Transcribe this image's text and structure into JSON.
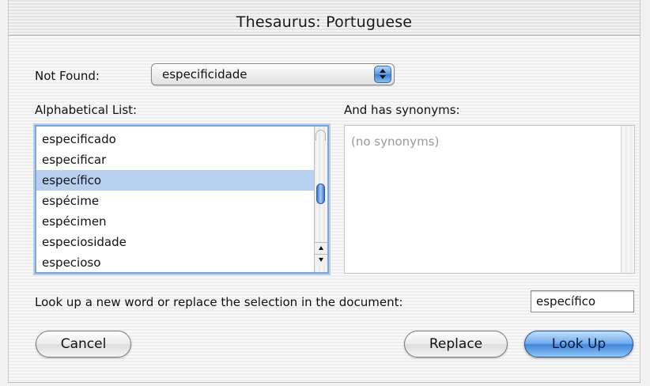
{
  "window": {
    "title": "Thesaurus: Portuguese"
  },
  "not_found": {
    "label": "Not Found:",
    "selected": "especificidade"
  },
  "alphabetical_list": {
    "label": "Alphabetical List:",
    "items": [
      "especificado",
      "especificar",
      "específico",
      "espécime",
      "espécimen",
      "especiosidade",
      "especioso"
    ],
    "selected": "específico"
  },
  "synonyms": {
    "label": "And has synonyms:",
    "placeholder": "(no synonyms)"
  },
  "lookup": {
    "label": "Look up a new word or replace the selection in the document:",
    "value": "específico"
  },
  "buttons": {
    "cancel": "Cancel",
    "replace": "Replace",
    "look_up": "Look Up"
  },
  "colors": {
    "accent": "#3f85dc",
    "selection": "#b8d0f0"
  }
}
